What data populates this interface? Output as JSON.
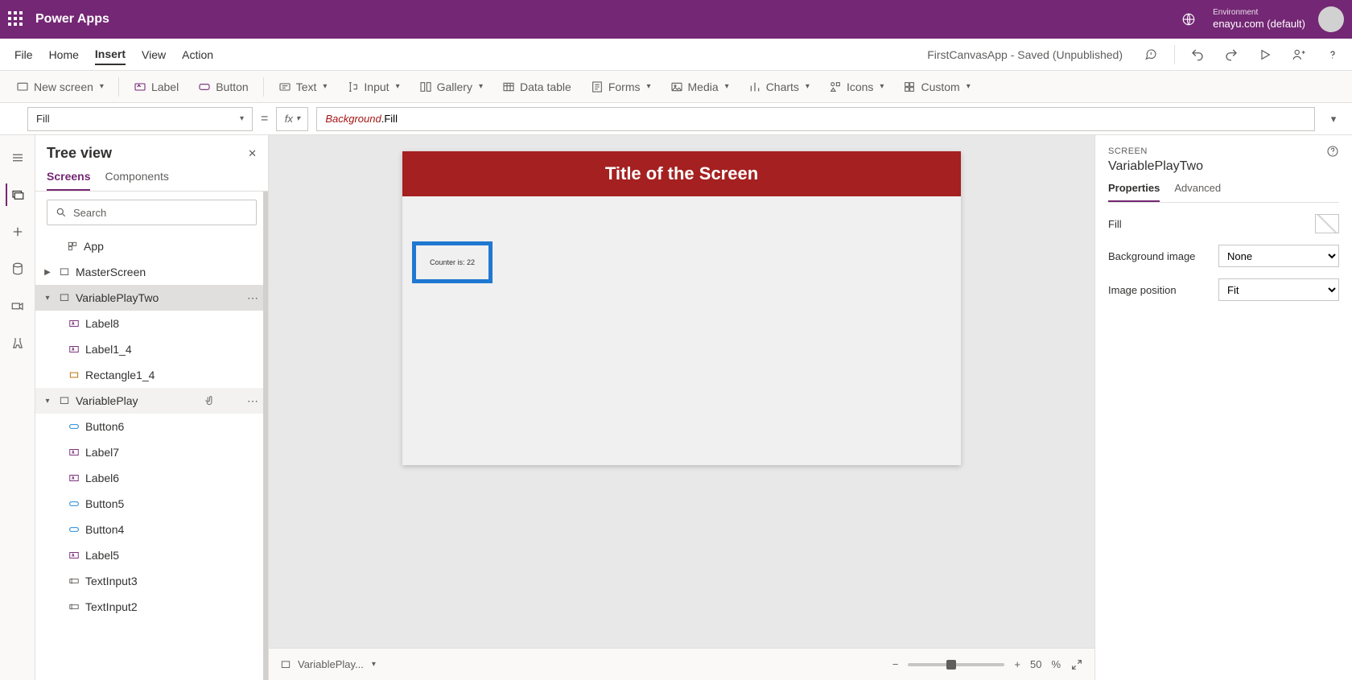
{
  "topbar": {
    "app_title": "Power Apps",
    "env_label": "Environment",
    "env_name": "enayu.com (default)"
  },
  "menubar": {
    "items": [
      "File",
      "Home",
      "Insert",
      "View",
      "Action"
    ],
    "active_index": 2,
    "file_status": "FirstCanvasApp - Saved (Unpublished)"
  },
  "ribbon": {
    "new_screen": "New screen",
    "label": "Label",
    "button": "Button",
    "text": "Text",
    "input": "Input",
    "gallery": "Gallery",
    "data_table": "Data table",
    "forms": "Forms",
    "media": "Media",
    "charts": "Charts",
    "icons": "Icons",
    "custom": "Custom"
  },
  "formula": {
    "property": "Fill",
    "token1": "Background",
    "token2": ".Fill"
  },
  "treeview": {
    "title": "Tree view",
    "tabs": [
      "Screens",
      "Components"
    ],
    "active_tab": 0,
    "search_placeholder": "Search",
    "app": "App",
    "items": [
      {
        "name": "MasterScreen",
        "type": "screen",
        "expanded": false
      },
      {
        "name": "VariablePlayTwo",
        "type": "screen",
        "expanded": true,
        "selected": true
      },
      {
        "name": "Label8",
        "type": "label",
        "child": true
      },
      {
        "name": "Label1_4",
        "type": "label",
        "child": true
      },
      {
        "name": "Rectangle1_4",
        "type": "rect",
        "child": true
      },
      {
        "name": "VariablePlay",
        "type": "screen",
        "expanded": true,
        "hover": true
      },
      {
        "name": "Button6",
        "type": "button",
        "child": true
      },
      {
        "name": "Label7",
        "type": "label",
        "child": true
      },
      {
        "name": "Label6",
        "type": "label",
        "child": true
      },
      {
        "name": "Button5",
        "type": "button",
        "child": true
      },
      {
        "name": "Button4",
        "type": "button",
        "child": true
      },
      {
        "name": "Label5",
        "type": "label",
        "child": true
      },
      {
        "name": "TextInput3",
        "type": "textinput",
        "child": true
      },
      {
        "name": "TextInput2",
        "type": "textinput",
        "child": true
      }
    ]
  },
  "canvas": {
    "title": "Title of the Screen",
    "counter": "Counter is: 22",
    "breadcrumb": "VariablePlay...",
    "zoom_percent": "50",
    "zoom_unit": "%"
  },
  "props": {
    "type_label": "SCREEN",
    "name": "VariablePlayTwo",
    "tabs": [
      "Properties",
      "Advanced"
    ],
    "active_tab": 0,
    "fill_label": "Fill",
    "bgimage_label": "Background image",
    "bgimage_value": "None",
    "imgpos_label": "Image position",
    "imgpos_value": "Fit"
  }
}
